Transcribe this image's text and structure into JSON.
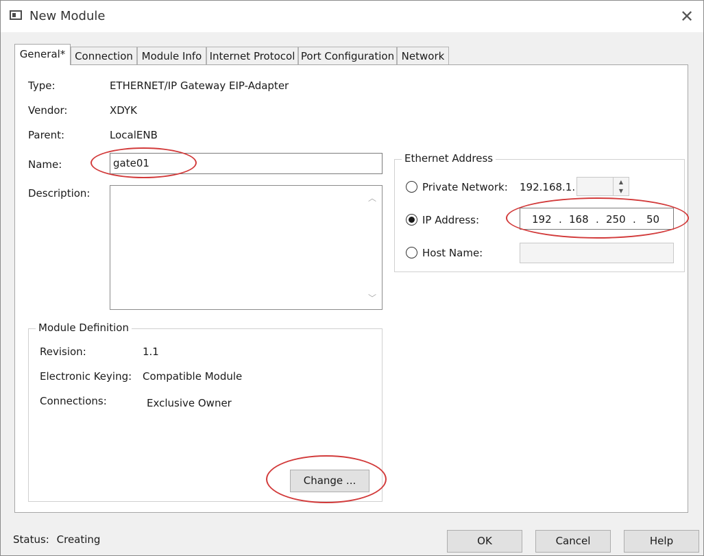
{
  "window": {
    "title": "New Module",
    "close_symbol": "✕"
  },
  "tabs": [
    {
      "label": "General*"
    },
    {
      "label": "Connection"
    },
    {
      "label": "Module Info"
    },
    {
      "label": "Internet Protocol"
    },
    {
      "label": "Port Configuration"
    },
    {
      "label": "Network"
    }
  ],
  "general": {
    "type_label": "Type:",
    "type_value": "ETHERNET/IP Gateway EIP-Adapter",
    "vendor_label": "Vendor:",
    "vendor_value": "XDYK",
    "parent_label": "Parent:",
    "parent_value": "LocalENB",
    "name_label": "Name:",
    "name_value": "gate01",
    "description_label": "Description:",
    "description_value": ""
  },
  "ethernet": {
    "legend": "Ethernet Address",
    "private_label": "Private Network:",
    "private_prefix": "192.168.1.",
    "private_value": "",
    "ip_label": "IP Address:",
    "ip_octets": [
      "192",
      "168",
      "250",
      "50"
    ],
    "ip_separator": ".",
    "host_label": "Host Name:",
    "host_value": "",
    "selected": "ip"
  },
  "module_definition": {
    "legend": "Module Definition",
    "revision_label": "Revision:",
    "revision_value": "1.1",
    "keying_label": "Electronic Keying:",
    "keying_value": "Compatible Module",
    "connections_label": "Connections:",
    "connections_value": "Exclusive Owner",
    "change_button": "Change ..."
  },
  "footer": {
    "status_label": "Status:",
    "status_value": "Creating",
    "ok": "OK",
    "cancel": "Cancel",
    "help": "Help"
  },
  "colors": {
    "highlight_oval": "#d23a3a",
    "window_bg": "#f0f0f0",
    "panel_bg": "#ffffff"
  },
  "icons": {
    "app": "module-window-icon",
    "close": "close-icon",
    "spin_up": "spin-up-icon",
    "spin_down": "spin-down-icon",
    "scroll_up": "chevron-up-icon",
    "scroll_down": "chevron-down-icon"
  }
}
